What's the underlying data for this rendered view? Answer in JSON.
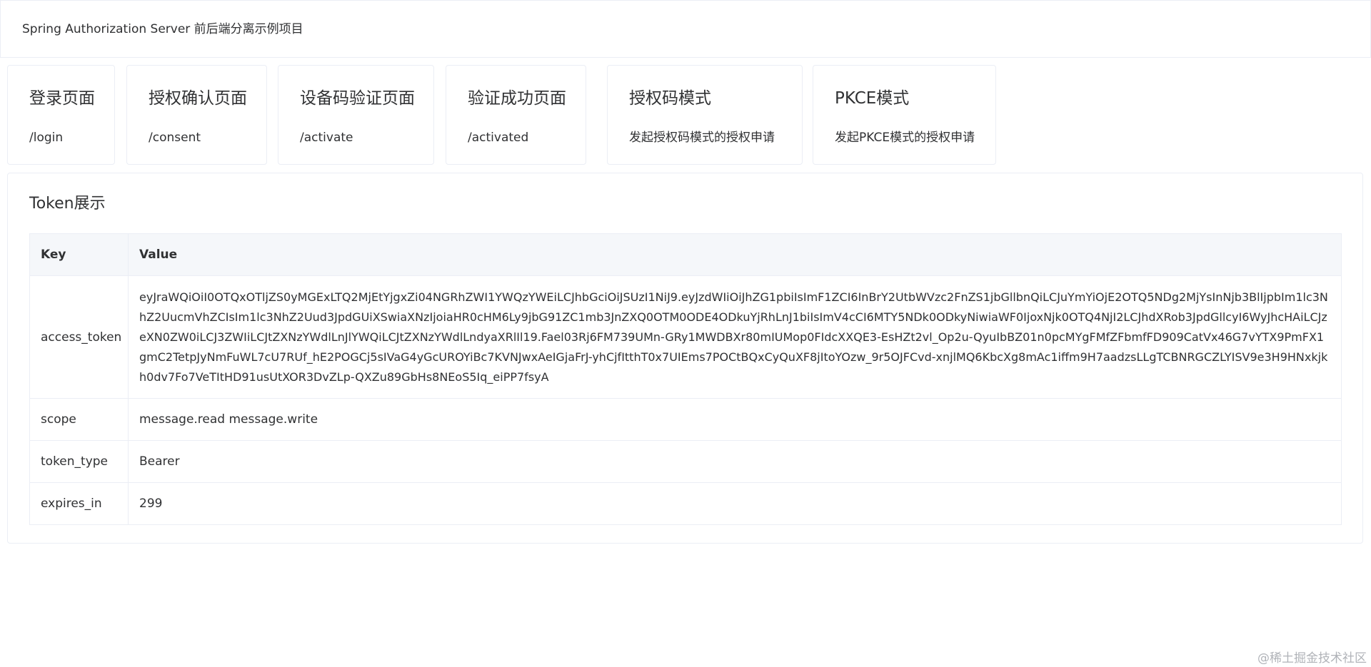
{
  "header": {
    "title": "Spring Authorization Server 前后端分离示例项目"
  },
  "cards": [
    {
      "title": "登录页面",
      "desc": "/login"
    },
    {
      "title": "授权确认页面",
      "desc": "/consent"
    },
    {
      "title": "设备码验证页面",
      "desc": "/activate"
    },
    {
      "title": "验证成功页面",
      "desc": "/activated"
    },
    {
      "title": "授权码模式",
      "desc": "发起授权码模式的授权申请"
    },
    {
      "title": "PKCE模式",
      "desc": "发起PKCE模式的授权申请"
    }
  ],
  "token": {
    "title": "Token展示",
    "columns": {
      "key": "Key",
      "value": "Value"
    },
    "rows": [
      {
        "key": "access_token",
        "value": "eyJraWQiOiI0OTQxOTljZS0yMGExLTQ2MjEtYjgxZi04NGRhZWI1YWQzYWEiLCJhbGciOiJSUzI1NiJ9.eyJzdWIiOiJhZG1pbiIsImF1ZCI6InBrY2UtbWVzc2FnZS1jbGllbnQiLCJuYmYiOjE2OTQ5NDg2MjYsInNjb3BlIjpbIm1lc3NhZ2UucmVhZCIsIm1lc3NhZ2Uud3JpdGUiXSwiaXNzIjoiaHR0cHM6Ly9jbG91ZC1mb3JnZXQ0OTM0ODE4ODkuYjRhLnJ1biIsImV4cCI6MTY5NDk0ODkyNiwiaWF0IjoxNjk0OTQ4NjI2LCJhdXRob3JpdGllcyI6WyJhcHAiLCJzeXN0ZW0iLCJ3ZWIiLCJtZXNzYWdlLnJlYWQiLCJtZXNzYWdlLndyaXRlIl19.Fael03Rj6FM739UMn-GRy1MWDBXr80mIUMop0FIdcXXQE3-EsHZt2vl_Op2u-QyuIbBZ01n0pcMYgFMfZFbmfFD909CatVx46G7vYTX9PmFX1gmC2TetpJyNmFuWL7cU7RUf_hE2POGCj5sIVaG4yGcUROYiBc7KVNJwxAeIGjaFrJ-yhCjfItthT0x7UIEms7POCtBQxCyQuXF8jItoYOzw_9r5OJFCvd-xnjlMQ6KbcXg8mAc1iffm9H7aadzsLLgTCBNRGCZLYISV9e3H9HNxkjkh0dv7Fo7VeTItHD91usUtXOR3DvZLp-QXZu89GbHs8NEoS5Iq_eiPP7fsyA"
      },
      {
        "key": "scope",
        "value": "message.read message.write"
      },
      {
        "key": "token_type",
        "value": "Bearer"
      },
      {
        "key": "expires_in",
        "value": "299"
      }
    ]
  },
  "watermark": "@稀土掘金技术社区"
}
